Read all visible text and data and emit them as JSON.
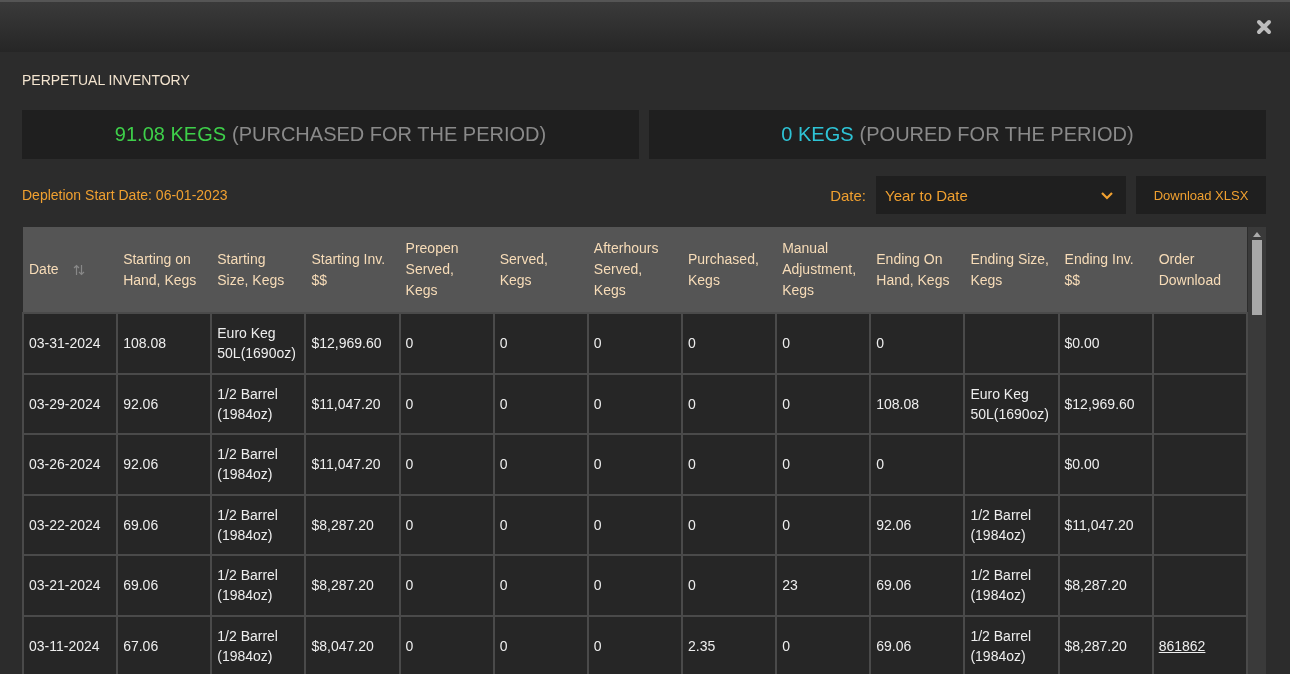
{
  "title": "PERPETUAL INVENTORY",
  "summaries": [
    {
      "value": "91.08 KEGS",
      "label": "(PURCHASED FOR THE PERIOD)",
      "color": "#3ecf4a"
    },
    {
      "value": "0 KEGS",
      "label": "(POURED FOR THE PERIOD)",
      "color": "#2ec4d6"
    }
  ],
  "depletion_start": "Depletion Start Date: 06-01-2023",
  "date_filter": {
    "label": "Date:",
    "value": "Year to Date"
  },
  "download_button": "Download XLSX",
  "table": {
    "columns": [
      "Date",
      "Starting on Hand, Kegs",
      "Starting Size, Kegs",
      "Starting Inv. $$",
      "Preopen Served, Kegs",
      "Served, Kegs",
      "Afterhours Served, Kegs",
      "Purchased, Kegs",
      "Manual Adjustment, Kegs",
      "Ending On Hand, Kegs",
      "Ending Size, Kegs",
      "Ending Inv. $$",
      "Order Download"
    ],
    "rows": [
      {
        "cells": [
          "03-31-2024",
          "108.08",
          "Euro Keg 50L(1690oz)",
          "$12,969.60",
          "0",
          "0",
          "0",
          "0",
          "0",
          "0",
          null,
          "$0.00",
          null
        ]
      },
      {
        "cells": [
          "03-29-2024",
          "92.06",
          "1/2 Barrel (1984oz)",
          "$11,047.20",
          "0",
          "0",
          "0",
          "0",
          "0",
          "108.08",
          "Euro Keg 50L(1690oz)",
          "$12,969.60",
          null
        ]
      },
      {
        "cells": [
          "03-26-2024",
          "92.06",
          "1/2 Barrel (1984oz)",
          "$11,047.20",
          "0",
          "0",
          "0",
          "0",
          "0",
          "0",
          null,
          "$0.00",
          null
        ]
      },
      {
        "cells": [
          "03-22-2024",
          "69.06",
          "1/2 Barrel (1984oz)",
          "$8,287.20",
          "0",
          "0",
          "0",
          "0",
          "0",
          "92.06",
          "1/2 Barrel (1984oz)",
          "$11,047.20",
          null
        ]
      },
      {
        "cells": [
          "03-21-2024",
          "69.06",
          "1/2 Barrel (1984oz)",
          "$8,287.20",
          "0",
          "0",
          "0",
          "0",
          "23",
          "69.06",
          "1/2 Barrel (1984oz)",
          "$8,287.20",
          null
        ]
      },
      {
        "cells": [
          "03-11-2024",
          "67.06",
          "1/2 Barrel (1984oz)",
          "$8,047.20",
          "0",
          "0",
          "0",
          "2.35",
          "0",
          "69.06",
          "1/2 Barrel (1984oz)",
          "$8,287.20",
          "861862"
        ]
      }
    ]
  }
}
